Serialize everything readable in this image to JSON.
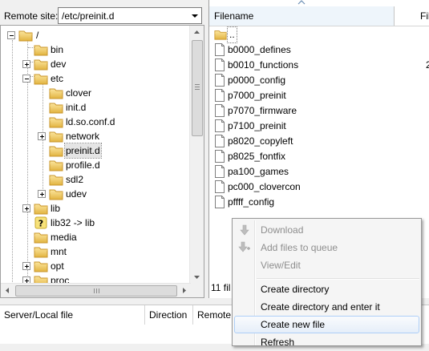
{
  "remote_site": {
    "label": "Remote site:",
    "path": "/etc/preinit.d"
  },
  "tree": {
    "root_label": "/",
    "items": [
      {
        "label": "bin"
      },
      {
        "label": "dev"
      },
      {
        "label": "etc"
      },
      {
        "label": "clover"
      },
      {
        "label": "init.d"
      },
      {
        "label": "ld.so.conf.d"
      },
      {
        "label": "network"
      },
      {
        "label": "preinit.d"
      },
      {
        "label": "profile.d"
      },
      {
        "label": "sdl2"
      },
      {
        "label": "udev"
      },
      {
        "label": "lib"
      },
      {
        "label": "lib32 -> lib"
      },
      {
        "label": "media"
      },
      {
        "label": "mnt"
      },
      {
        "label": "opt"
      },
      {
        "label": "proc"
      }
    ],
    "unknown_glyph": "?"
  },
  "file_list": {
    "columns": [
      "Filename",
      "Fil"
    ],
    "parent_label": "..",
    "files": [
      {
        "name": "b0000_defines",
        "size": ""
      },
      {
        "name": "b0010_functions",
        "size": "2"
      },
      {
        "name": "p0000_config",
        "size": ""
      },
      {
        "name": "p7000_preinit",
        "size": ""
      },
      {
        "name": "p7070_firmware",
        "size": ""
      },
      {
        "name": "p7100_preinit",
        "size": ""
      },
      {
        "name": "p8020_copyleft",
        "size": ""
      },
      {
        "name": "p8025_fontfix",
        "size": ""
      },
      {
        "name": "pa100_games",
        "size": ""
      },
      {
        "name": "pc000_clovercon",
        "size": ""
      },
      {
        "name": "pffff_config",
        "size": ""
      }
    ],
    "status": "11 fil"
  },
  "queue": {
    "columns": [
      "Server/Local file",
      "Direction",
      "Remote"
    ]
  },
  "context_menu": {
    "items": [
      {
        "label": "Download",
        "icon": "download-arrow-icon"
      },
      {
        "label": "Add files to queue",
        "icon": "add-to-queue-icon"
      },
      {
        "label": "View/Edit"
      },
      {
        "label": "Create directory"
      },
      {
        "label": "Create directory and enter it"
      },
      {
        "label": "Create new file"
      },
      {
        "label": "Refresh"
      }
    ]
  },
  "colors": {
    "folder": "#e9c35a",
    "menu_hover_border": "#aecff7",
    "header_active": "#eef5fb"
  }
}
